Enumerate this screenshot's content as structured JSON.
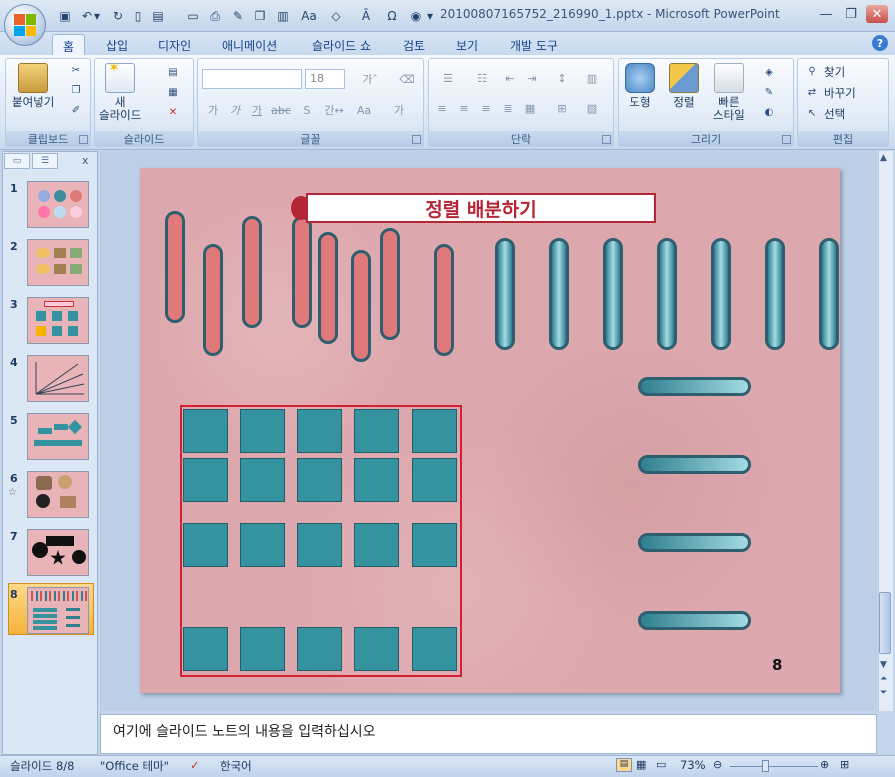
{
  "window": {
    "title": "20100807165752_216990_1.pptx - Microsoft PowerPoint",
    "minimize": "—",
    "restore": "❐",
    "close": "✕"
  },
  "qat": {
    "icons": [
      "save-icon",
      "undo-icon",
      "redo-icon",
      "new-icon",
      "new-slide-icon",
      "open-icon",
      "print-icon",
      "format-icon",
      "copy-icon",
      "paste-icon",
      "font-size-icon",
      "shapes-icon",
      "char-icon",
      "omega-icon",
      "more-icon"
    ],
    "dropdown": "▾"
  },
  "tabs": [
    "홈",
    "삽입",
    "디자인",
    "애니메이션",
    "슬라이드 쇼",
    "검토",
    "보기",
    "개발 도구"
  ],
  "ribbon": {
    "clipboard": {
      "label": "클립보드",
      "paste": "붙여넣기"
    },
    "slides": {
      "label": "슬라이드",
      "new_slide_1": "새",
      "new_slide_2": "슬라이드"
    },
    "font": {
      "label": "글꼴",
      "size": "18"
    },
    "paragraph": {
      "label": "단락"
    },
    "drawing": {
      "label": "그리기",
      "shape": "도형",
      "arrange": "정렬",
      "quick_styles_1": "빠른",
      "quick_styles_2": "스타일"
    },
    "editing": {
      "label": "편집",
      "find": "찾기",
      "replace": "바꾸기",
      "select": "선택"
    }
  },
  "pane": {
    "close": "x",
    "slide_numbers": [
      "1",
      "2",
      "3",
      "4",
      "5",
      "6",
      "7",
      "8"
    ],
    "selected": 8
  },
  "slide": {
    "title": "정렬 배분하기",
    "number": "8"
  },
  "notes": {
    "placeholder": "여기에 슬라이드 노트의 내용을 입력하십시오"
  },
  "status": {
    "slide": "슬라이드 8/8",
    "theme": "\"Office 테마\"",
    "language": "한국어",
    "zoom": "73%"
  },
  "colors": {
    "red_pill": "#e07a7a",
    "teal": "#35939f",
    "title_red": "#b42535",
    "slide_bg": "#dda8ad"
  }
}
